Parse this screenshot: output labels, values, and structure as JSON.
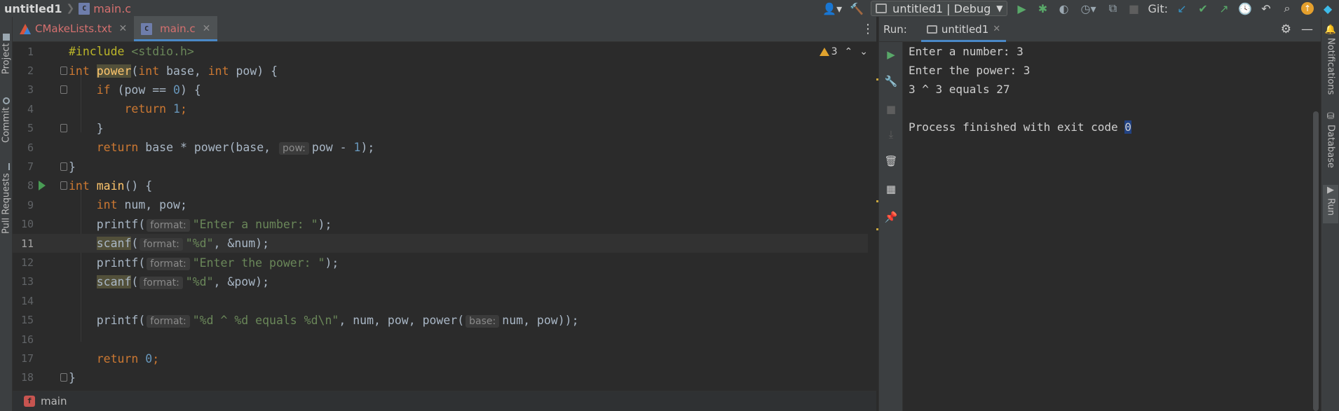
{
  "topbar": {
    "project": "untitled1",
    "file": "main.c",
    "run_config": "untitled1 | Debug",
    "git_label": "Git:"
  },
  "left_strip": {
    "tabs": [
      "Project",
      "Commit",
      "Pull Requests"
    ]
  },
  "right_strip": {
    "tabs": [
      "Notifications",
      "Database",
      "Run"
    ]
  },
  "editor": {
    "tabs": [
      {
        "label": "CMakeLists.txt",
        "active": false
      },
      {
        "label": "main.c",
        "active": true
      }
    ],
    "warning_count": "3",
    "lines": [
      {
        "n": "1"
      },
      {
        "n": "2"
      },
      {
        "n": "3"
      },
      {
        "n": "4"
      },
      {
        "n": "5"
      },
      {
        "n": "6"
      },
      {
        "n": "7"
      },
      {
        "n": "8"
      },
      {
        "n": "9"
      },
      {
        "n": "10"
      },
      {
        "n": "11"
      },
      {
        "n": "12"
      },
      {
        "n": "13"
      },
      {
        "n": "14"
      },
      {
        "n": "15"
      },
      {
        "n": "16"
      },
      {
        "n": "17"
      },
      {
        "n": "18"
      }
    ],
    "code": {
      "l1_pre": "#include",
      "l1_hdr": "<stdio.h>",
      "l2_kw1": "int",
      "l2_fn": "power",
      "l2_a": "(",
      "l2_kw2": "int",
      "l2_b": " base, ",
      "l2_kw3": "int",
      "l2_c": " pow) {",
      "l3_kw": "if",
      "l3_a": " (pow == ",
      "l3_num": "0",
      "l3_b": ") {",
      "l4_kw": "return",
      "l4_num": "1",
      "l4_b": ";",
      "l5": "}",
      "l6_kw": "return",
      "l6_a": " base * power(base, ",
      "l6_hint": "pow:",
      "l6_b": "pow - ",
      "l6_num": "1",
      "l6_c": ");",
      "l7": "}",
      "l8_kw": "int",
      "l8_fn": "main",
      "l8_a": "() {",
      "l9_kw": "int",
      "l9_a": " num, pow;",
      "l10_a": "printf(",
      "l10_hint": "format:",
      "l10_str": "\"Enter a number: \"",
      "l10_b": ");",
      "l11_fn": "scanf",
      "l11_a": "(",
      "l11_hint": "format:",
      "l11_str": "\"%d\"",
      "l11_b": ", &num);",
      "l12_a": "printf(",
      "l12_hint": "format:",
      "l12_str": "\"Enter the power: \"",
      "l12_b": ");",
      "l13_fn": "scanf",
      "l13_a": "(",
      "l13_hint": "format:",
      "l13_str": "\"%d\"",
      "l13_b": ", &pow);",
      "l15_a": "printf(",
      "l15_hint1": "format:",
      "l15_str": "\"%d ^ %d equals %d\\n\"",
      "l15_b": ", num, pow, power(",
      "l15_hint2": "base:",
      "l15_c": "num, pow));",
      "l17_kw": "return",
      "l17_num": "0",
      "l17_b": ";",
      "l18": "}"
    },
    "status_function": "main"
  },
  "run_panel": {
    "title": "Run:",
    "tab": "untitled1",
    "console": {
      "line1": "Enter a number: 3",
      "line2": "Enter the power: 3",
      "line3": "3 ^ 3 equals 27",
      "line5_text": "Process finished with exit code ",
      "line5_code": "0"
    }
  },
  "colors": {
    "keyword": "#cc7832",
    "string": "#6a8759",
    "number": "#6897bb",
    "function": "#ffc66d",
    "accent": "#4a88c7"
  }
}
